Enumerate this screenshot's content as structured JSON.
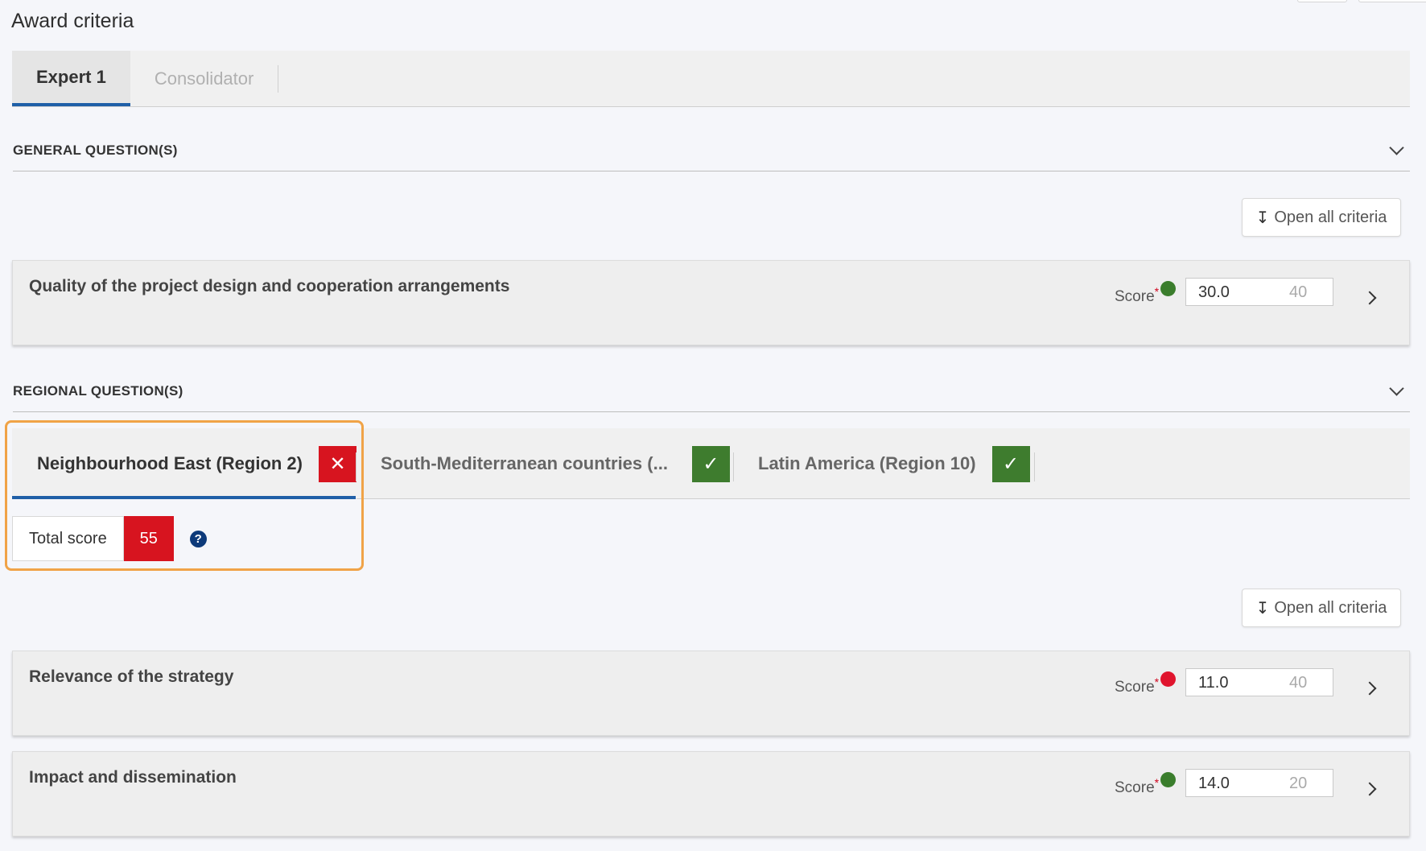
{
  "page": {
    "title": "Award criteria"
  },
  "tabs": [
    {
      "label": "Expert 1",
      "active": true
    },
    {
      "label": "Consolidator",
      "active": false
    }
  ],
  "general": {
    "title": "GENERAL QUESTION(S)",
    "open_all_label": "Open all criteria",
    "criteria": [
      {
        "title": "Quality of the project design and cooperation arrangements",
        "score_label": "Score",
        "score": "30.0",
        "max": "40",
        "status": "green"
      }
    ]
  },
  "regional": {
    "title": "REGIONAL QUESTION(S)",
    "tabs": [
      {
        "label": "Neighbourhood East (Region 2)",
        "status_symbol": "✕",
        "status": "invalid"
      },
      {
        "label": "South-Mediterranean countries (...",
        "status_symbol": "✓",
        "status": "valid"
      },
      {
        "label": "Latin America (Region 10)",
        "status_symbol": "✓",
        "status": "valid"
      }
    ],
    "total_score_label": "Total score",
    "total_score": "55",
    "help_symbol": "?",
    "open_all_label": "Open all criteria",
    "criteria": [
      {
        "title": "Relevance of the strategy",
        "score_label": "Score",
        "score": "11.0",
        "max": "40",
        "status": "red"
      },
      {
        "title": "Impact and dissemination",
        "score_label": "Score",
        "score": "14.0",
        "max": "20",
        "status": "green"
      }
    ]
  },
  "colors": {
    "accent_blue": "#1f5fa7",
    "status_green": "#3e7c2e",
    "status_red": "#d7141f",
    "highlight_orange": "#f0a347",
    "dot_green": "#3a7d2c",
    "dot_red": "#e0142d"
  },
  "icons": {
    "open_all": "arrow-down-icon",
    "section_toggle": "chevron-down-icon",
    "row_expand": "chevron-right-icon",
    "help": "question-circle-icon"
  }
}
